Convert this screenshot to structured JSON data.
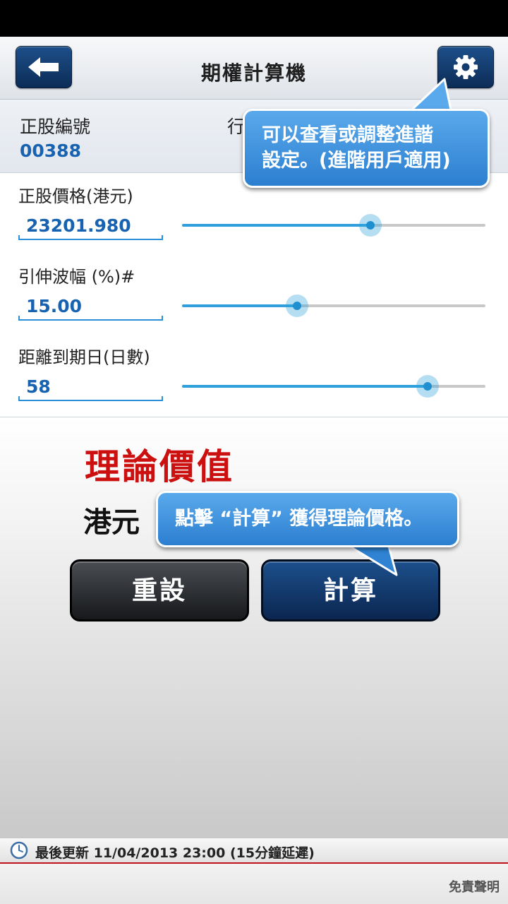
{
  "nav": {
    "title": "期權計算機"
  },
  "stock": {
    "label": "正股編號",
    "code": "00388",
    "strike_label": "行"
  },
  "fields": [
    {
      "label": "正股價格(港元)",
      "value": "23201.980",
      "slider_fraction": 0.62
    },
    {
      "label": "引伸波幅 (%)#",
      "value": "15.00",
      "slider_fraction": 0.38
    },
    {
      "label": "距離到期日(日數)",
      "value": "58",
      "slider_fraction": 0.81
    }
  ],
  "result": {
    "title": "理論價值",
    "currency": "港元"
  },
  "buttons": {
    "reset": "重設",
    "calculate": "計算"
  },
  "footer": {
    "update_text": "最後更新 11/04/2013 23:00 (15分鐘延遲)",
    "disclaimer": "免責聲明"
  },
  "tooltips": {
    "settings_line1": "可以查看或調整進諧",
    "settings_line2": "設定。(進階用戶適用)",
    "calculate": "點擊 “計算” 獲得理論價格。"
  },
  "colors": {
    "accent": "#1763b1",
    "result_red": "#cc0f0f",
    "tooltip_blue": "#3b8fe0",
    "slider_blue": "#2fa0dc"
  },
  "icons": {
    "back": "back-arrow-icon",
    "settings": "gear-icon",
    "clock": "clock-icon"
  }
}
